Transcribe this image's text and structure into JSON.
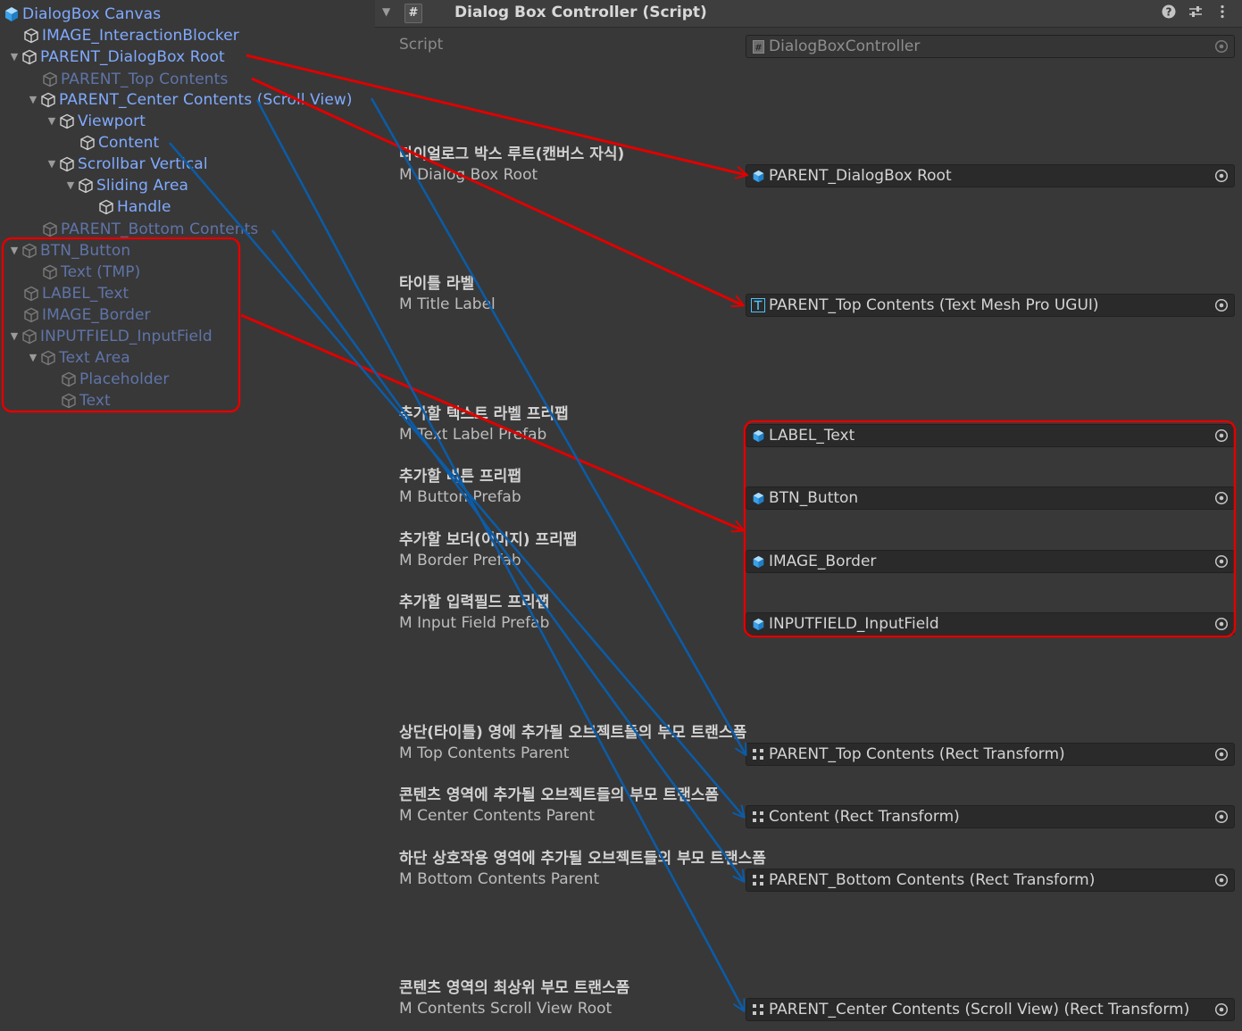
{
  "hierarchy": {
    "items": [
      {
        "label": "DialogBox Canvas",
        "fold": "",
        "icon": "prefab-icon"
      },
      {
        "label": "IMAGE_InteractionBlocker",
        "fold": "",
        "icon": "gameobject-icon"
      },
      {
        "label": "PARENT_DialogBox Root",
        "fold": "▼",
        "icon": "gameobject-icon"
      },
      {
        "label": "PARENT_Top Contents",
        "fold": "",
        "icon": "gameobject-icon"
      },
      {
        "label": "PARENT_Center Contents (Scroll View)",
        "fold": "▼",
        "icon": "gameobject-icon"
      },
      {
        "label": "Viewport",
        "fold": "▼",
        "icon": "gameobject-icon"
      },
      {
        "label": "Content",
        "fold": "",
        "icon": "gameobject-icon"
      },
      {
        "label": "Scrollbar Vertical",
        "fold": "▼",
        "icon": "gameobject-icon"
      },
      {
        "label": "Sliding Area",
        "fold": "▼",
        "icon": "gameobject-icon"
      },
      {
        "label": "Handle",
        "fold": "",
        "icon": "gameobject-icon"
      },
      {
        "label": "PARENT_Bottom Contents",
        "fold": "",
        "icon": "gameobject-icon"
      },
      {
        "label": "BTN_Button",
        "fold": "▼",
        "icon": "gameobject-icon"
      },
      {
        "label": "Text (TMP)",
        "fold": "",
        "icon": "gameobject-icon"
      },
      {
        "label": "LABEL_Text",
        "fold": "",
        "icon": "gameobject-icon"
      },
      {
        "label": "IMAGE_Border",
        "fold": "",
        "icon": "gameobject-icon"
      },
      {
        "label": "INPUTFIELD_InputField",
        "fold": "▼",
        "icon": "gameobject-icon"
      },
      {
        "label": "Text Area",
        "fold": "▼",
        "icon": "gameobject-icon"
      },
      {
        "label": "Placeholder",
        "fold": "",
        "icon": "gameobject-icon"
      },
      {
        "label": "Text",
        "fold": "",
        "icon": "gameobject-icon"
      }
    ]
  },
  "inspector": {
    "component_title": "Dialog Box Controller (Script)",
    "header_icons": [
      "help-icon",
      "preset-icon",
      "more-menu-icon"
    ],
    "script_label": "Script",
    "script_value": "DialogBoxController",
    "sections": [
      {
        "heading": "다이얼로그 박스 루트(캔버스 자식)",
        "label": "M Dialog Box Root",
        "field": "PARENT_DialogBox Root",
        "icon": "prefab-icon"
      },
      {
        "heading": "타이틀 라벨",
        "label": "M Title Label",
        "field": "PARENT_Top Contents (Text Mesh Pro UGUI)",
        "icon": "textmeshpro-icon"
      },
      {
        "heading": "추가할 텍스트 라벨 프리팹",
        "label": "M Text Label Prefab",
        "field": "LABEL_Text",
        "icon": "prefab-icon"
      },
      {
        "heading": "추가할 버튼 프리팹",
        "label": "M Button Prefab",
        "field": "BTN_Button",
        "icon": "prefab-icon"
      },
      {
        "heading": "추가할 보더(이미지) 프리팹",
        "label": "M Border Prefab",
        "field": "IMAGE_Border",
        "icon": "prefab-icon"
      },
      {
        "heading": "추가할 입력필드 프리팹",
        "label": "M Input Field Prefab",
        "field": "INPUTFIELD_InputField",
        "icon": "prefab-icon"
      },
      {
        "heading": "상단(타이틀) 영에 추가될 오브젝트들의 부모 트랜스폼",
        "label": "M Top Contents Parent",
        "field": "PARENT_Top Contents (Rect Transform)",
        "icon": "recttransform-icon"
      },
      {
        "heading": "콘텐츠 영역에 추가될 오브젝트들의 부모 트랜스폼",
        "label": "M Center Contents Parent",
        "field": "Content (Rect Transform)",
        "icon": "recttransform-icon"
      },
      {
        "heading": "하단 상호작용 영역에 추가될 오브젝트들의 부모 트랜스폼",
        "label": "M Bottom Contents Parent",
        "field": "PARENT_Bottom Contents (Rect Transform)",
        "icon": "recttransform-icon"
      },
      {
        "heading": "콘텐츠 영역의 최상위 부모 트랜스폼",
        "label": "M Contents Scroll View Root",
        "field": "PARENT_Center Contents (Scroll View) (Rect Transform)",
        "icon": "recttransform-icon"
      }
    ]
  },
  "annotation_colors": {
    "red": "#e00000",
    "blue": "#0b5ca8",
    "highlight_box": "#e00000"
  }
}
